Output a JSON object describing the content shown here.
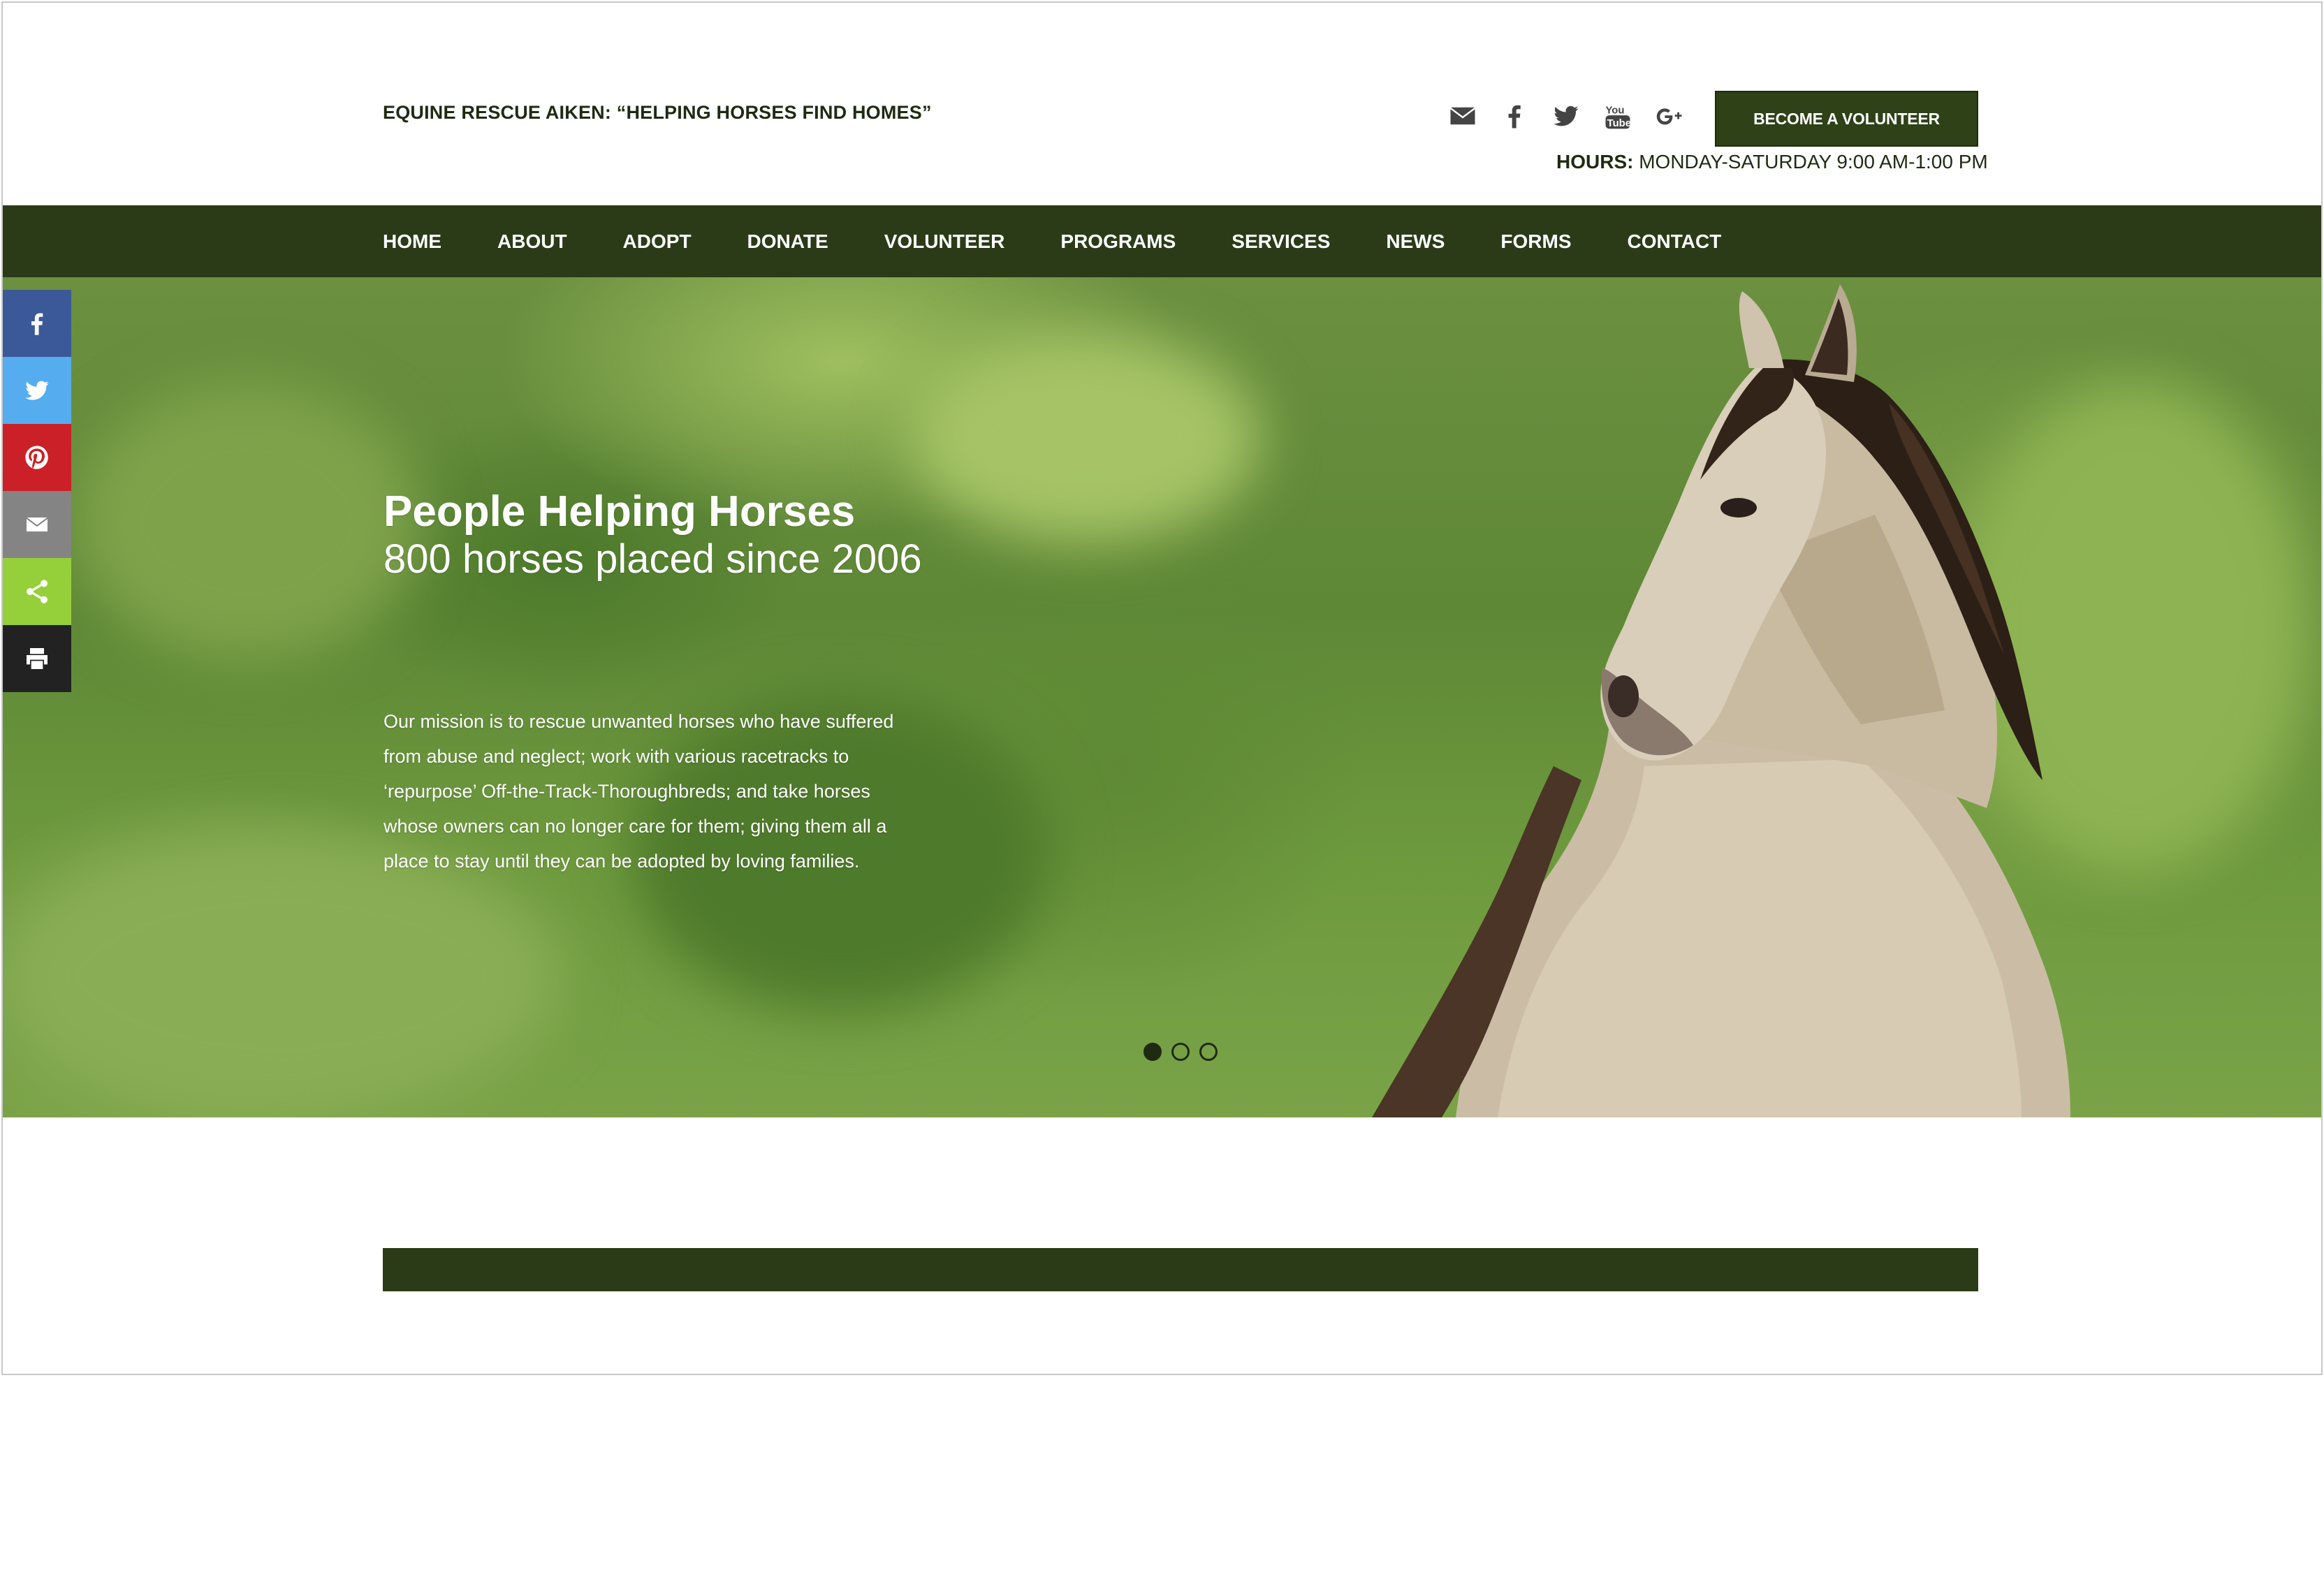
{
  "header": {
    "tagline": "EQUINE RESCUE AIKEN: “HELPING HORSES FIND HOMES”",
    "social_icons": [
      "envelope-icon",
      "facebook-icon",
      "twitter-icon",
      "youtube-icon",
      "google-plus-icon"
    ],
    "volunteer_button": "BECOME A VOLUNTEER",
    "hours_label": "HOURS:",
    "hours_value": "MONDAY-SATURDAY 9:00 AM-1:00 PM"
  },
  "nav": {
    "items": [
      "HOME",
      "ABOUT",
      "ADOPT",
      "DONATE",
      "VOLUNTEER",
      "PROGRAMS",
      "SERVICES",
      "NEWS",
      "FORMS",
      "CONTACT"
    ],
    "active": "HOME"
  },
  "hero": {
    "title": "People Helping Horses",
    "subtitle": "800 horses placed since 2006",
    "body": "Our mission is to rescue unwanted horses who have suffered from abuse and neglect; work with various racetracks to ‘repurpose’ Off-the-Track-Thoroughbreds; and take horses whose owners can no longer care for them; giving them all a place to stay until they can be adopted by loving families.",
    "slides": 3,
    "active_slide": 1
  },
  "share_bar": {
    "icons": [
      "facebook-icon",
      "twitter-icon",
      "pinterest-icon",
      "email-icon",
      "share-icon",
      "print-icon"
    ]
  },
  "colors": {
    "brand_dark_green": "#2b3b18",
    "facebook": "#3b5998",
    "twitter": "#55acee",
    "pinterest": "#cb2027",
    "email": "#848484",
    "share": "#95d03a",
    "print": "#222222"
  }
}
